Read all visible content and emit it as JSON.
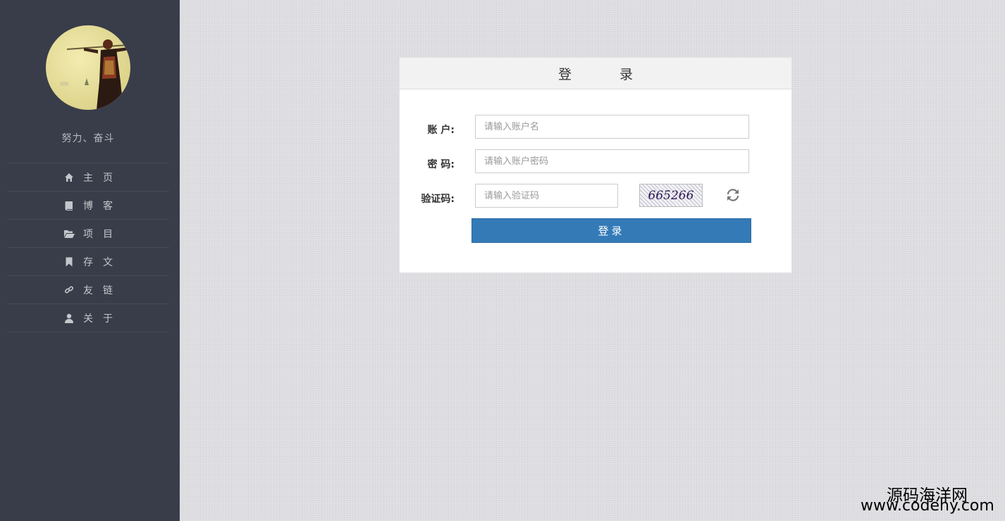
{
  "sidebar": {
    "motto": "努力、奋斗",
    "items": [
      {
        "label": "主页",
        "icon": "home-icon"
      },
      {
        "label": "博客",
        "icon": "book-icon"
      },
      {
        "label": "项目",
        "icon": "folder-open-icon"
      },
      {
        "label": "存文",
        "icon": "bookmark-icon"
      },
      {
        "label": "友链",
        "icon": "link-icon"
      },
      {
        "label": "关于",
        "icon": "user-icon"
      }
    ]
  },
  "login": {
    "title": "登录",
    "account_label": "账 户:",
    "account_placeholder": "请输入账户名",
    "password_label": "密 码:",
    "password_placeholder": "请输入账户密码",
    "captcha_label": "验证码:",
    "captcha_placeholder": "请输入验证码",
    "captcha_text": "665266",
    "submit_label": "登录"
  },
  "watermark": {
    "line1": "源码海洋网",
    "line2": "www.codehy.com"
  },
  "colors": {
    "sidebar_bg": "#393d49",
    "primary_button": "#337ab7",
    "page_bg": "#dddde1"
  }
}
